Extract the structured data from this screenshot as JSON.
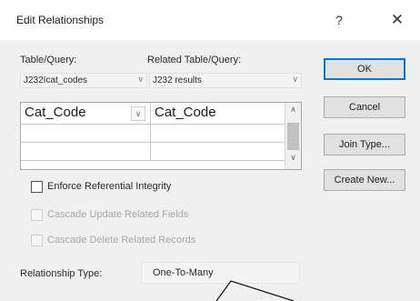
{
  "window": {
    "title": "Edit Relationships",
    "help_glyph": "?",
    "close_glyph": "✕"
  },
  "labels": {
    "table_query": "Table/Query:",
    "related_table_query": "Related Table/Query:"
  },
  "table_combo": {
    "value": "J232Icat_codes"
  },
  "related_combo": {
    "value": "J232 results"
  },
  "field_grid": {
    "rows": [
      {
        "left": "Cat_Code",
        "right": "Cat_Code"
      },
      {
        "left": "",
        "right": ""
      },
      {
        "left": "",
        "right": ""
      }
    ]
  },
  "options": {
    "enforce": {
      "label": "Enforce Referential Integrity",
      "checked": false,
      "enabled": true
    },
    "cascade_update": {
      "label": "Cascade Update Related Fields",
      "checked": false,
      "enabled": false
    },
    "cascade_delete": {
      "label": "Cascade Delete Related Records",
      "checked": false,
      "enabled": false
    }
  },
  "relationship_type": {
    "label": "Relationship Type:",
    "value": "One-To-Many"
  },
  "buttons": {
    "ok": "OK",
    "cancel": "Cancel",
    "join_type": "Join Type...",
    "create_new": "Create New..."
  },
  "icons": {
    "dropdown": "chevron-down-icon",
    "scroll_up": "arrow-up-icon",
    "scroll_down": "arrow-down-icon"
  },
  "colors": {
    "dialog_bg": "#f0f0f0",
    "default_button_border": "#0078d7"
  }
}
